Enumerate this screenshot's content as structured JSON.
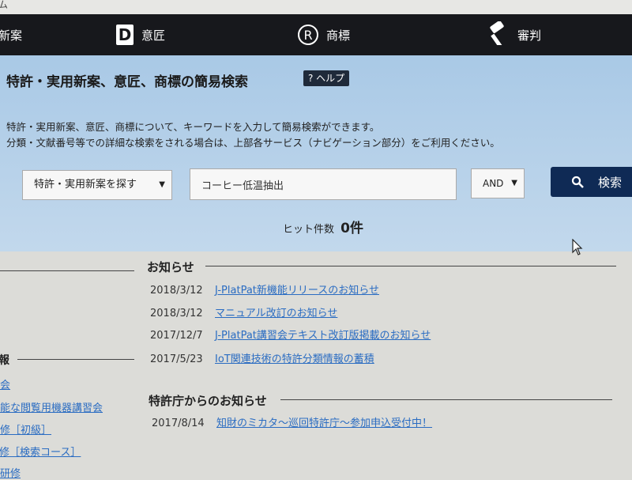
{
  "top": {
    "fragment": "ム"
  },
  "nav": [
    {
      "label": "新案",
      "icon": "none"
    },
    {
      "label": "意匠",
      "icon": "design-d-icon"
    },
    {
      "label": "商標",
      "icon": "trademark-r-icon"
    },
    {
      "label": "審判",
      "icon": "gavel-icon"
    }
  ],
  "hero": {
    "title": "特許・実用新案、意匠、商標の簡易検索",
    "help": "? ヘルプ",
    "desc1": "特許・実用新案、意匠、商標について、キーワードを入力して簡易検索ができます。",
    "desc2": "分類・文献番号等での詳細な検索をされる場合は、上部各サービス（ナビゲーション部分）をご利用ください。"
  },
  "search": {
    "category": "特許・実用新案を探す",
    "keyword": "コーヒー低温抽出",
    "operator": "AND",
    "button": "検索",
    "hits_label": "ヒット件数",
    "hits_count": "0件"
  },
  "news": {
    "title": "お知らせ",
    "items": [
      {
        "date": "2018/3/12",
        "text": "J-PlatPat新機能リリースのお知らせ"
      },
      {
        "date": "2018/3/12",
        "text": "マニュアル改訂のお知らせ"
      },
      {
        "date": "2017/12/7",
        "text": "J-PlatPat講習会テキスト改訂版掲載のお知らせ"
      },
      {
        "date": "2017/5/23",
        "text": "IoT関連技術の特許分類情報の蓄積"
      }
    ]
  },
  "jpo": {
    "title": "特許庁からのお知らせ",
    "items": [
      {
        "date": "2017/8/14",
        "text": "知財のミカタ～巡回特許庁～参加申込受付中！"
      }
    ]
  },
  "sidebar": {
    "heading": "報",
    "items": [
      "会",
      "能な閲覧用機器講習会",
      "修［初級］",
      "研修［検索コース］",
      "研修"
    ]
  }
}
